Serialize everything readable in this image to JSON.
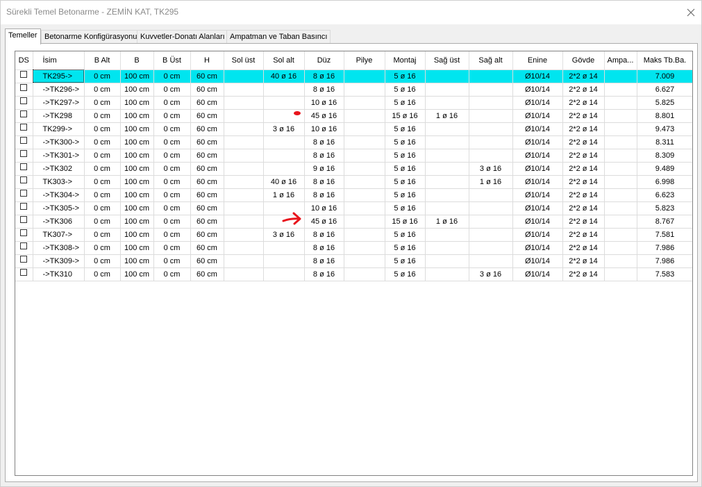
{
  "window": {
    "title": "Sürekli Temel Betonarme - ZEMİN KAT, TK295"
  },
  "tabs": [
    {
      "label": "Temeller",
      "active": true
    },
    {
      "label": "Betonarme Konfigürasyonu",
      "active": false
    },
    {
      "label": "Kuvvetler-Donatı Alanları",
      "active": false
    },
    {
      "label": "Ampatman ve Taban Basıncı",
      "active": false
    }
  ],
  "columns": [
    "DS",
    "İsim",
    "B Alt",
    "B",
    "B Üst",
    "H",
    "Sol üst",
    "Sol alt",
    "Düz",
    "Pilye",
    "Montaj",
    "Sağ üst",
    "Sağ alt",
    "Enine",
    "Gövde",
    "Ampa...",
    "Maks Tb.Ba."
  ],
  "rows": [
    [
      "",
      "TK295->",
      "0 cm",
      "100 cm",
      "0 cm",
      "60 cm",
      "",
      "40 ø 16",
      "8 ø 16",
      "",
      "5 ø 16",
      "",
      "",
      "Ø10/14",
      "2*2 ø 14",
      "",
      "7.009"
    ],
    [
      "",
      "->TK296->",
      "0 cm",
      "100 cm",
      "0 cm",
      "60 cm",
      "",
      "",
      "8 ø 16",
      "",
      "5 ø 16",
      "",
      "",
      "Ø10/14",
      "2*2 ø 14",
      "",
      "6.627"
    ],
    [
      "",
      "->TK297->",
      "0 cm",
      "100 cm",
      "0 cm",
      "60 cm",
      "",
      "",
      "10 ø 16",
      "",
      "5 ø 16",
      "",
      "",
      "Ø10/14",
      "2*2 ø 14",
      "",
      "5.825"
    ],
    [
      "",
      "->TK298",
      "0 cm",
      "100 cm",
      "0 cm",
      "60 cm",
      "",
      "",
      "45 ø 16",
      "",
      "15 ø 16",
      "1 ø 16",
      "",
      "Ø10/14",
      "2*2 ø 14",
      "",
      "8.801"
    ],
    [
      "",
      "TK299->",
      "0 cm",
      "100 cm",
      "0 cm",
      "60 cm",
      "",
      "3 ø 16",
      "10 ø 16",
      "",
      "5 ø 16",
      "",
      "",
      "Ø10/14",
      "2*2 ø 14",
      "",
      "9.473"
    ],
    [
      "",
      "->TK300->",
      "0 cm",
      "100 cm",
      "0 cm",
      "60 cm",
      "",
      "",
      "8 ø 16",
      "",
      "5 ø 16",
      "",
      "",
      "Ø10/14",
      "2*2 ø 14",
      "",
      "8.311"
    ],
    [
      "",
      "->TK301->",
      "0 cm",
      "100 cm",
      "0 cm",
      "60 cm",
      "",
      "",
      "8 ø 16",
      "",
      "5 ø 16",
      "",
      "",
      "Ø10/14",
      "2*2 ø 14",
      "",
      "8.309"
    ],
    [
      "",
      "->TK302",
      "0 cm",
      "100 cm",
      "0 cm",
      "60 cm",
      "",
      "",
      "9 ø 16",
      "",
      "5 ø 16",
      "",
      "3 ø 16",
      "Ø10/14",
      "2*2 ø 14",
      "",
      "9.489"
    ],
    [
      "",
      "TK303->",
      "0 cm",
      "100 cm",
      "0 cm",
      "60 cm",
      "",
      "40 ø 16",
      "8 ø 16",
      "",
      "5 ø 16",
      "",
      "1 ø 16",
      "Ø10/14",
      "2*2 ø 14",
      "",
      "6.998"
    ],
    [
      "",
      "->TK304->",
      "0 cm",
      "100 cm",
      "0 cm",
      "60 cm",
      "",
      "1 ø 16",
      "8 ø 16",
      "",
      "5 ø 16",
      "",
      "",
      "Ø10/14",
      "2*2 ø 14",
      "",
      "6.623"
    ],
    [
      "",
      "->TK305->",
      "0 cm",
      "100 cm",
      "0 cm",
      "60 cm",
      "",
      "",
      "10 ø 16",
      "",
      "5 ø 16",
      "",
      "",
      "Ø10/14",
      "2*2 ø 14",
      "",
      "5.823"
    ],
    [
      "",
      "->TK306",
      "0 cm",
      "100 cm",
      "0 cm",
      "60 cm",
      "",
      "",
      "45 ø 16",
      "",
      "15 ø 16",
      "1 ø 16",
      "",
      "Ø10/14",
      "2*2 ø 14",
      "",
      "8.767"
    ],
    [
      "",
      "TK307->",
      "0 cm",
      "100 cm",
      "0 cm",
      "60 cm",
      "",
      "3 ø 16",
      "8 ø 16",
      "",
      "5 ø 16",
      "",
      "",
      "Ø10/14",
      "2*2 ø 14",
      "",
      "7.581"
    ],
    [
      "",
      "->TK308->",
      "0 cm",
      "100 cm",
      "0 cm",
      "60 cm",
      "",
      "",
      "8 ø 16",
      "",
      "5 ø 16",
      "",
      "",
      "Ø10/14",
      "2*2 ø 14",
      "",
      "7.986"
    ],
    [
      "",
      "->TK309->",
      "0 cm",
      "100 cm",
      "0 cm",
      "60 cm",
      "",
      "",
      "8 ø 16",
      "",
      "5 ø 16",
      "",
      "",
      "Ø10/14",
      "2*2 ø 14",
      "",
      "7.986"
    ],
    [
      "",
      "->TK310",
      "0 cm",
      "100 cm",
      "0 cm",
      "60 cm",
      "",
      "",
      "8 ø 16",
      "",
      "5 ø 16",
      "",
      "3 ø 16",
      "Ø10/14",
      "2*2 ø 14",
      "",
      "7.583"
    ]
  ],
  "selected_row": 0,
  "colors": {
    "selection": "#00e5ef",
    "annotation": "#e8141c"
  },
  "icons": {
    "close": "close-icon",
    "checkbox": "checkbox-icon",
    "annotation": [
      "annotation-dot-icon",
      "annotation-arrow-icon"
    ]
  }
}
